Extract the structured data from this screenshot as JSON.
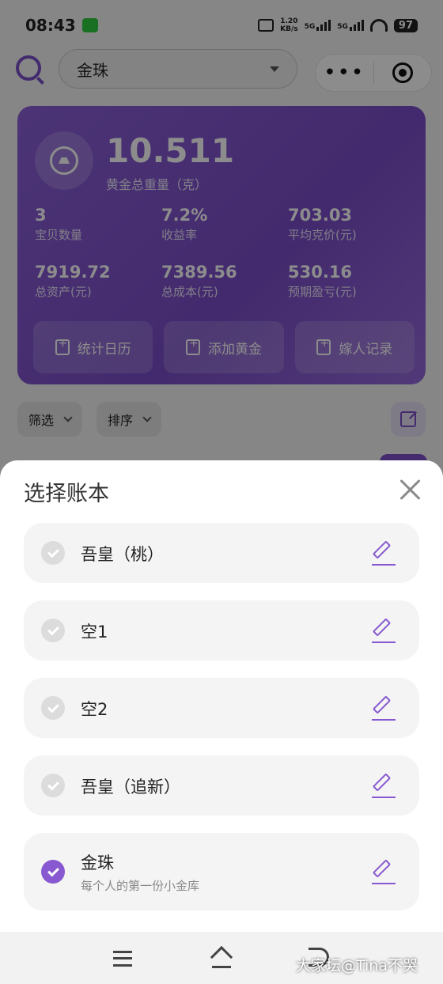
{
  "status_bar": {
    "time": "08:43",
    "net_speed_top": "1.20",
    "net_speed_bottom": "KB/s",
    "sig1": "5G",
    "sig2": "5G",
    "battery": "97"
  },
  "header": {
    "book_select_value": "金珠",
    "capsule_more": "•••"
  },
  "summary": {
    "total_weight": "10.511",
    "total_weight_label": "黄金总重量（克）",
    "stats": [
      {
        "value": "3",
        "label": "宝贝数量"
      },
      {
        "value": "7.2%",
        "label": "收益率"
      },
      {
        "value": "703.03",
        "label": "平均克价(元)"
      },
      {
        "value": "7919.72",
        "label": "总资产(元)"
      },
      {
        "value": "7389.56",
        "label": "总成本(元)"
      },
      {
        "value": "530.16",
        "label": "预期盈亏(元)"
      }
    ],
    "actions": [
      {
        "label": "统计日历"
      },
      {
        "label": "添加黄金"
      },
      {
        "label": "嫁人记录"
      }
    ]
  },
  "filters": {
    "filter_label": "筛选",
    "sort_label": "排序"
  },
  "sheet": {
    "title": "选择账本",
    "books": [
      {
        "name": "吾皇（桃）",
        "subtitle": "",
        "selected": false
      },
      {
        "name": "空1",
        "subtitle": "",
        "selected": false
      },
      {
        "name": "空2",
        "subtitle": "",
        "selected": false
      },
      {
        "name": "吾皇（追新）",
        "subtitle": "",
        "selected": false
      },
      {
        "name": "金珠",
        "subtitle": "每个人的第一份小金库",
        "selected": true
      }
    ]
  },
  "watermark": "大家坛@Tina不哭",
  "colors": {
    "accent": "#8758d0",
    "card_purple": "#7a4dc8"
  }
}
